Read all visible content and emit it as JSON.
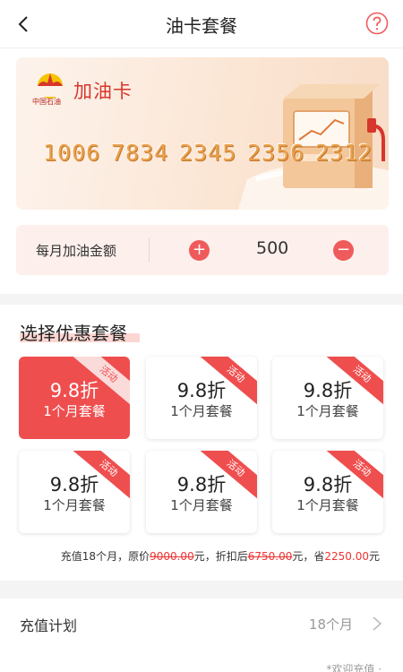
{
  "header": {
    "title": "油卡套餐"
  },
  "card": {
    "name": "加油卡",
    "brand": "中国石油",
    "number_groups": [
      "1006",
      "7834",
      "2345",
      "2356",
      "2312"
    ]
  },
  "amount": {
    "label": "每月加油金额",
    "value": "500",
    "plus": "+",
    "minus": "−"
  },
  "section": {
    "title": "选择优惠套餐"
  },
  "packages": [
    {
      "price": "9.8折",
      "desc": "1个月套餐",
      "badge": "活动"
    },
    {
      "price": "9.8折",
      "desc": "1个月套餐",
      "badge": "活动"
    },
    {
      "price": "9.8折",
      "desc": "1个月套餐",
      "badge": "活动"
    },
    {
      "price": "9.8折",
      "desc": "1个月套餐",
      "badge": "活动"
    },
    {
      "price": "9.8折",
      "desc": "1个月套餐",
      "badge": "活动"
    },
    {
      "price": "9.8折",
      "desc": "1个月套餐",
      "badge": "活动"
    }
  ],
  "summary": {
    "prefix": "充值18个月，原价",
    "original": "9000.00",
    "mid": "元，折扣后",
    "discounted": "6750.00",
    "mid2": "元，省",
    "saved": "2250.00",
    "suffix": "元"
  },
  "plan": {
    "label": "充值计划",
    "value": "18个月"
  },
  "footer_hint": "*欢迎充值 ·",
  "colors": {
    "accent": "#ef4e4e",
    "brand_red": "#d7362c",
    "card_digits": "#e9a04d"
  }
}
